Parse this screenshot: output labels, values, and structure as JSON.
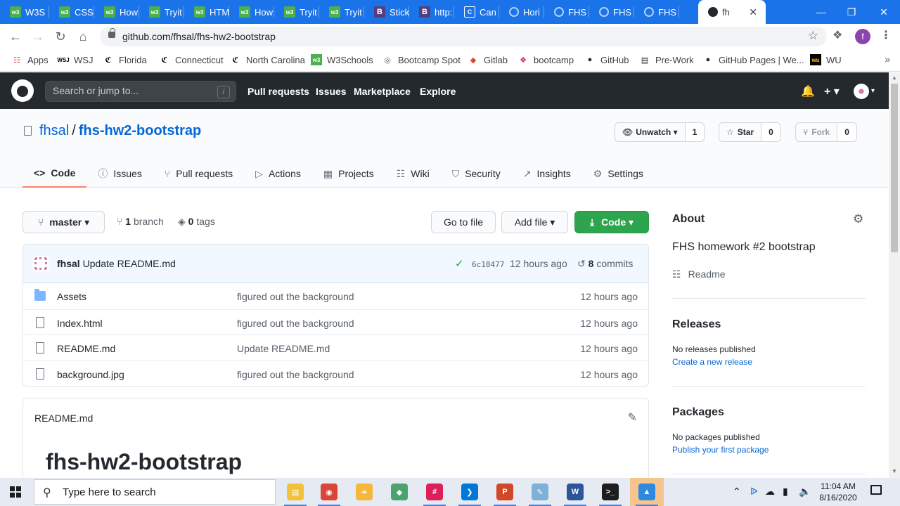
{
  "browser": {
    "tabs": [
      {
        "title": "W3S",
        "icon": "w3schools-icon"
      },
      {
        "title": "CSS",
        "icon": "w3schools-icon"
      },
      {
        "title": "How",
        "icon": "w3schools-icon"
      },
      {
        "title": "Tryit",
        "icon": "w3schools-icon"
      },
      {
        "title": "HTM",
        "icon": "w3schools-icon"
      },
      {
        "title": "How",
        "icon": "w3schools-icon"
      },
      {
        "title": "Tryit",
        "icon": "w3schools-icon"
      },
      {
        "title": "Tryit",
        "icon": "w3schools-icon"
      },
      {
        "title": "Stick",
        "icon": "bootstrap-icon"
      },
      {
        "title": "http:",
        "icon": "bootstrap-icon"
      },
      {
        "title": "Can",
        "icon": "canvas-icon"
      },
      {
        "title": "Hori",
        "icon": "github-icon"
      },
      {
        "title": "FHS",
        "icon": "github-icon"
      },
      {
        "title": "FHS",
        "icon": "github-icon"
      },
      {
        "title": "FHS",
        "icon": "github-icon"
      },
      {
        "title": "fh",
        "icon": "github-icon",
        "active": true
      }
    ],
    "url": "github.com/fhsal/fhs-hw2-bootstrap",
    "profile_initial": "f",
    "bookmarks": [
      {
        "label": "Apps",
        "icon": "apps-grid-icon"
      },
      {
        "label": "WSJ",
        "icon": "wsj-icon",
        "icon_text": "WSJ"
      },
      {
        "label": "Florida",
        "icon": "newspaper-icon",
        "icon_text": "ℭ"
      },
      {
        "label": "Connecticut",
        "icon": "newspaper-icon",
        "icon_text": "ℭ"
      },
      {
        "label": "North Carolina",
        "icon": "newspaper-icon",
        "icon_text": "ℭ"
      },
      {
        "label": "W3Schools",
        "icon": "w3schools-icon"
      },
      {
        "label": "Bootcamp Spot",
        "icon": "globe-icon"
      },
      {
        "label": "Gitlab",
        "icon": "gitlab-icon"
      },
      {
        "label": "bootcamp",
        "icon": "slack-icon"
      },
      {
        "label": "GitHub",
        "icon": "github-icon"
      },
      {
        "label": "Pre-Work",
        "icon": "book-icon"
      },
      {
        "label": "GitHub Pages | We...",
        "icon": "github-icon"
      },
      {
        "label": "WU",
        "icon": "wu-icon"
      }
    ]
  },
  "github": {
    "search_placeholder": "Search or jump to...",
    "search_key": "/",
    "nav": [
      "Pull requests",
      "Issues",
      "Marketplace",
      "Explore"
    ],
    "plus": "+ ▾"
  },
  "repo": {
    "owner": "fhsal",
    "separator": "/",
    "name": "fhs-hw2-bootstrap",
    "watch": {
      "label": "Unwatch ▾",
      "count": "1"
    },
    "star": {
      "label": "Star",
      "count": "0"
    },
    "fork": {
      "label": "Fork",
      "count": "0"
    },
    "tabs": [
      {
        "label": "Code",
        "icon": "code-icon",
        "glyph": "<>",
        "active": true
      },
      {
        "label": "Issues",
        "icon": "issue-icon",
        "glyph": "ⓘ"
      },
      {
        "label": "Pull requests",
        "icon": "pull-request-icon",
        "glyph": "⑂"
      },
      {
        "label": "Actions",
        "icon": "play-icon",
        "glyph": "▷"
      },
      {
        "label": "Projects",
        "icon": "project-icon",
        "glyph": "▦"
      },
      {
        "label": "Wiki",
        "icon": "book-icon",
        "glyph": "☷"
      },
      {
        "label": "Security",
        "icon": "shield-icon",
        "glyph": "⛉"
      },
      {
        "label": "Insights",
        "icon": "graph-icon",
        "glyph": "↗"
      },
      {
        "label": "Settings",
        "icon": "gear-icon",
        "glyph": "⚙"
      }
    ]
  },
  "main": {
    "branch_button": "master ▾",
    "branch_count": "1",
    "branch_label": "branch",
    "tag_count": "0",
    "tag_label": "tags",
    "go_to_file": "Go to file",
    "add_file": "Add file ▾",
    "code_button": "Code ▾",
    "latest_commit": {
      "author": "fhsal",
      "message": "Update README.md",
      "sha": "6c18477",
      "time": "12 hours ago",
      "commits_count": "8",
      "commits_label": "commits"
    },
    "files": [
      {
        "name": "Assets",
        "type": "dir",
        "message": "figured out the background",
        "age": "12 hours ago"
      },
      {
        "name": "Index.html",
        "type": "file",
        "message": "figured out the background",
        "age": "12 hours ago"
      },
      {
        "name": "README.md",
        "type": "file",
        "message": "Update README.md",
        "age": "12 hours ago"
      },
      {
        "name": "background.jpg",
        "type": "file",
        "message": "figured out the background",
        "age": "12 hours ago"
      }
    ],
    "readme": {
      "file": "README.md",
      "heading": "fhs-hw2-bootstrap"
    }
  },
  "sidebar": {
    "about_title": "About",
    "description": "FHS homework #2 bootstrap",
    "readme_link": "Readme",
    "releases_title": "Releases",
    "releases_text": "No releases published",
    "releases_link": "Create a new release",
    "packages_title": "Packages",
    "packages_text": "No packages published",
    "packages_link": "Publish your first package"
  },
  "taskbar": {
    "search_placeholder": "Type here to search",
    "apps": [
      {
        "name": "file-explorer",
        "color": "#f3c13a"
      },
      {
        "name": "chrome",
        "color": "#db4437"
      },
      {
        "name": "genie",
        "color": "#f6b73c"
      },
      {
        "name": "gitkraken",
        "color": "#4ba46d"
      },
      {
        "name": "slack",
        "color": "#e01e5a"
      },
      {
        "name": "vscode",
        "color": "#0078d7"
      },
      {
        "name": "powerpoint",
        "color": "#d24726"
      },
      {
        "name": "notepad",
        "color": "#7fb1d6"
      },
      {
        "name": "word",
        "color": "#2b579a"
      },
      {
        "name": "terminal",
        "color": "#1e1e1e"
      },
      {
        "name": "photos",
        "color": "#2d8ae0",
        "active": true
      }
    ],
    "time": "11:04 AM",
    "date": "8/16/2020"
  },
  "colors": {
    "chrome_blue": "#1a73e8",
    "github_header": "#24292e",
    "link": "#0366d6",
    "code_button": "#2ea44f",
    "active_tab_underline": "#f9826c"
  }
}
